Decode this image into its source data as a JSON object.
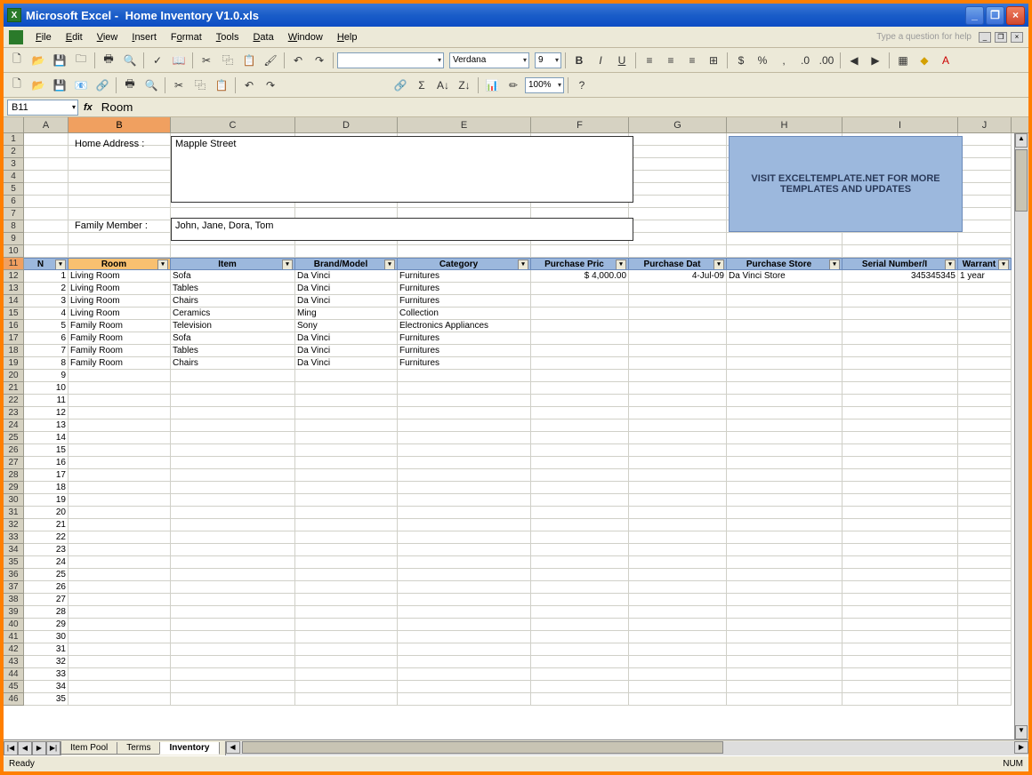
{
  "titlebar": {
    "app": "Microsoft Excel",
    "file": "Home Inventory V1.0.xls"
  },
  "menu": {
    "file": "File",
    "edit": "Edit",
    "view": "View",
    "insert": "Insert",
    "format": "Format",
    "tools": "Tools",
    "data": "Data",
    "window": "Window",
    "help": "Help",
    "helpbox": "Type a question for help"
  },
  "toolbar": {
    "font": "Verdana",
    "size": "9",
    "zoom": "100%"
  },
  "formula": {
    "cell": "B11",
    "value": "Room"
  },
  "columns": [
    "A",
    "B",
    "C",
    "D",
    "E",
    "F",
    "G",
    "H",
    "I",
    "J"
  ],
  "form": {
    "home_label": "Home Address :",
    "home_value": "Mapple Street",
    "family_label": "Family Member :",
    "family_value": "John, Jane, Dora, Tom",
    "promo": "VISIT EXCELTEMPLATE.NET FOR MORE TEMPLATES AND UPDATES"
  },
  "headers": {
    "A": "N",
    "B": "Room",
    "C": "Item",
    "D": "Brand/Model",
    "E": "Category",
    "F": "Purchase Pric",
    "G": "Purchase Dat",
    "H": "Purchase Store",
    "I": "Serial Number/I",
    "J": "Warrant"
  },
  "rows": [
    {
      "n": "1",
      "room": "Living Room",
      "item": "Sofa",
      "brand": "Da Vinci",
      "cat": "Furnitures",
      "price": "$        4,000.00",
      "date": "4-Jul-09",
      "store": "Da Vinci Store",
      "serial": "345345345",
      "warr": "1 year"
    },
    {
      "n": "2",
      "room": "Living Room",
      "item": "Tables",
      "brand": "Da Vinci",
      "cat": "Furnitures",
      "price": "",
      "date": "",
      "store": "",
      "serial": "",
      "warr": ""
    },
    {
      "n": "3",
      "room": "Living Room",
      "item": "Chairs",
      "brand": "Da Vinci",
      "cat": "Furnitures",
      "price": "",
      "date": "",
      "store": "",
      "serial": "",
      "warr": ""
    },
    {
      "n": "4",
      "room": "Living Room",
      "item": "Ceramics",
      "brand": "Ming",
      "cat": "Collection",
      "price": "",
      "date": "",
      "store": "",
      "serial": "",
      "warr": ""
    },
    {
      "n": "5",
      "room": "Family Room",
      "item": "Television",
      "brand": "Sony",
      "cat": "Electronics Appliances",
      "price": "",
      "date": "",
      "store": "",
      "serial": "",
      "warr": ""
    },
    {
      "n": "6",
      "room": "Family Room",
      "item": "Sofa",
      "brand": "Da Vinci",
      "cat": "Furnitures",
      "price": "",
      "date": "",
      "store": "",
      "serial": "",
      "warr": ""
    },
    {
      "n": "7",
      "room": "Family Room",
      "item": "Tables",
      "brand": "Da Vinci",
      "cat": "Furnitures",
      "price": "",
      "date": "",
      "store": "",
      "serial": "",
      "warr": ""
    },
    {
      "n": "8",
      "room": "Family Room",
      "item": "Chairs",
      "brand": "Da Vinci",
      "cat": "Furnitures",
      "price": "",
      "date": "",
      "store": "",
      "serial": "",
      "warr": ""
    }
  ],
  "empty_count": 27,
  "empty_start_n": 9,
  "sheet_tabs": {
    "t1": "Item Pool",
    "t2": "Terms",
    "t3": "Inventory"
  },
  "status": {
    "ready": "Ready",
    "num": "NUM"
  }
}
